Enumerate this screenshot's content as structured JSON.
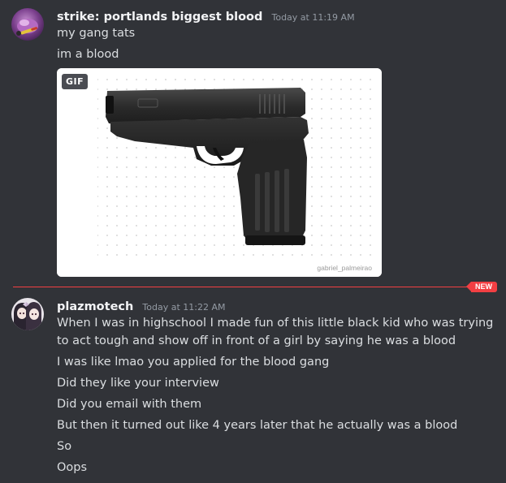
{
  "messages": [
    {
      "username": "strike: portlands biggest blood",
      "timestamp": "Today at 11:19 AM",
      "lines": [
        "my gang tats",
        "im a blood"
      ],
      "embed": {
        "badge": "GIF",
        "watermark": "gabriel_palmeirao",
        "icon": "pistol-image"
      }
    },
    {
      "username": "plazmotech",
      "timestamp": "Today at 11:22 AM",
      "lines": [
        "When I was in highschool I made fun of this little black kid who was trying",
        "to act tough and show off in front of a girl by saying he was a blood",
        "I was like lmao you applied for the blood gang",
        "Did they like your interview",
        "Did you email with them",
        "But then it turned out like 4 years later that he actually was a blood",
        "So",
        "Oops"
      ]
    }
  ],
  "divider": {
    "label": "NEW",
    "color": "#f23f43"
  },
  "colors": {
    "background": "#313338",
    "username": "#f2f3f5",
    "text": "#dbdee1",
    "timestamp": "#949ba4"
  }
}
